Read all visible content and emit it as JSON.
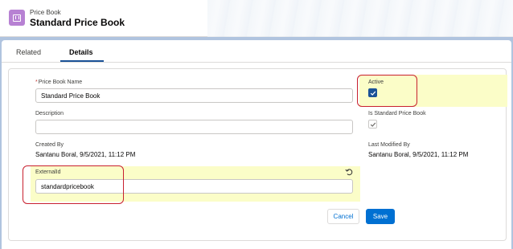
{
  "header": {
    "object_type": "Price Book",
    "record_title": "Standard Price Book",
    "icon": "price-book-icon"
  },
  "tabs": [
    {
      "label": "Related",
      "selected": false
    },
    {
      "label": "Details",
      "selected": true
    }
  ],
  "form": {
    "price_book_name": {
      "label": "Price Book Name",
      "required_marker": "*",
      "value": "Standard Price Book"
    },
    "active": {
      "label": "Active",
      "checked": true
    },
    "description": {
      "label": "Description",
      "value": ""
    },
    "is_standard": {
      "label": "Is Standard Price Book",
      "checked": true
    },
    "created_by": {
      "label": "Created By",
      "value": "Santanu Boral, 9/5/2021, 11:12 PM"
    },
    "last_modified_by": {
      "label": "Last Modified By",
      "value": "Santanu Boral, 9/5/2021, 11:12 PM"
    },
    "external_id": {
      "label": "ExternalId",
      "value": "standardpricebook"
    }
  },
  "buttons": {
    "cancel": "Cancel",
    "save": "Save"
  },
  "colors": {
    "brand": "#0070d2",
    "icon_bg": "#b781d3",
    "changed_field_highlight": "#fbfdc8",
    "annotation": "#c8202f"
  }
}
